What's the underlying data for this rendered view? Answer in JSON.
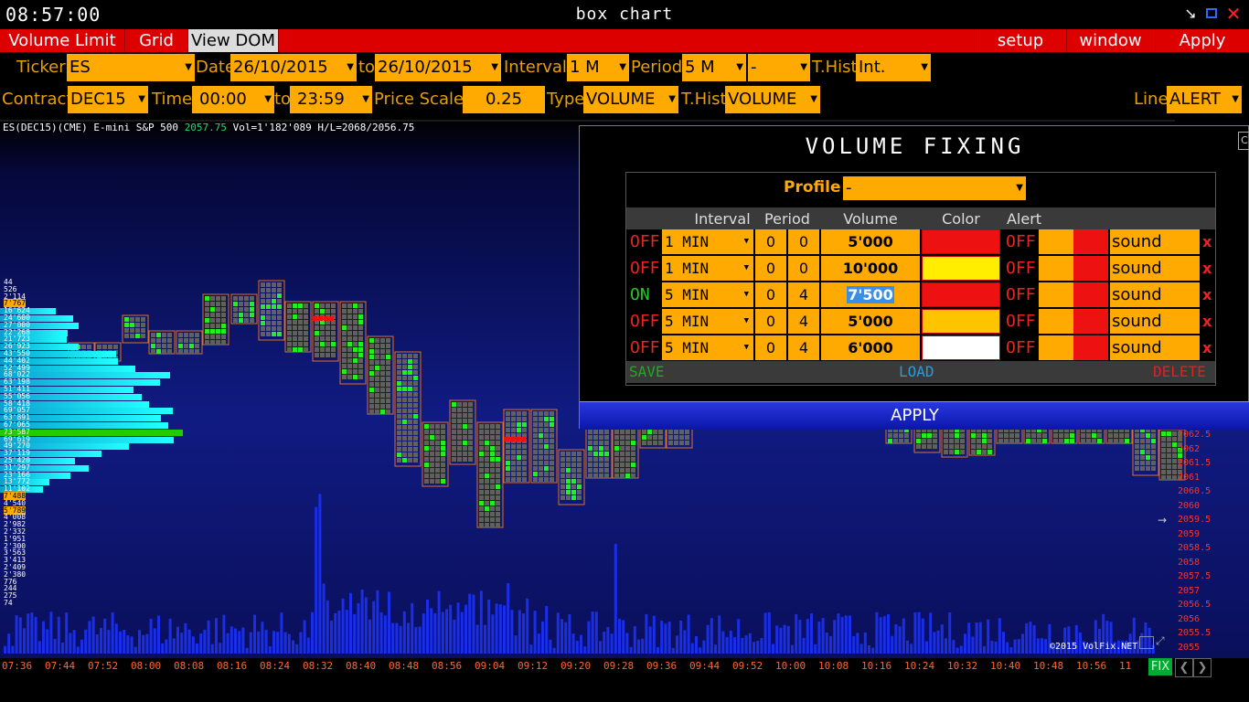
{
  "window": {
    "clock": "08:57:00",
    "title": "box chart"
  },
  "icons": {
    "minimize": "minimize-icon",
    "restore": "restore-icon",
    "close": "close-icon"
  },
  "menubar": {
    "left": [
      "Volume Limit",
      "Grid",
      "View DOM"
    ],
    "right": [
      "setup",
      "window",
      "Apply"
    ]
  },
  "params": {
    "ticker_label": "Ticker",
    "ticker": "ES",
    "date_label": "Date",
    "date_from": "26/10/2015",
    "to_label": "to",
    "date_to": "26/10/2015",
    "interval_label": "Interval",
    "interval": "1 M",
    "period_label": "Period",
    "period": "5 M",
    "period2": "-",
    "thist_label": "T.Hist",
    "thist1": "Int.",
    "contract_label": "Contract",
    "contract": "DEC15",
    "time_label": "Time",
    "time_from": "00:00",
    "time_to_label": "to",
    "time_to": "23:59",
    "price_scale_label": "Price Scale",
    "price_scale": "0.25",
    "type_label": "Type",
    "type": "VOLUME",
    "thist2_label": "T.Hist",
    "thist2": "VOLUME",
    "line_label": "Line",
    "line": "ALERT"
  },
  "chart": {
    "info_prefix": "ES(DEC15)(CME) E-mini S&P 500",
    "last_price": "2057.75",
    "info_suffix": "Vol=1'182'089 H/L=2068/2056.75",
    "copyright": "©2015 VolFix.NET",
    "profile_labels": [
      "44",
      "526",
      "2'114",
      "7'767",
      "16'624",
      "24'600",
      "27'000",
      "22'268",
      "21'723",
      "26'923",
      "43'550",
      "44'402",
      "52'499",
      "68'022",
      "63'198",
      "51'411",
      "55'056",
      "58'418",
      "69'057",
      "63'891",
      "67'065",
      "73'587",
      "69'619",
      "49'270",
      "37'119",
      "25'420",
      "31'297",
      "23'166",
      "13'772",
      "11'102",
      "7'488",
      "4'540",
      "5'789",
      "4'008",
      "2'982",
      "2'332",
      "1'951",
      "2'300",
      "3'563",
      "3'413",
      "2'409",
      "2'380",
      "776",
      "244",
      "275",
      "74"
    ],
    "price_levels": [
      "2062.5",
      "2062",
      "2061.5",
      "2061",
      "2060.5",
      "2060",
      "2059.5",
      "2059",
      "2058.5",
      "2058",
      "2057.5",
      "2057",
      "2056.5",
      "2056",
      "2055.5",
      "2055"
    ],
    "time_labels": [
      "07:36",
      "07:44",
      "07:52",
      "08:00",
      "08:08",
      "08:16",
      "08:24",
      "08:32",
      "08:40",
      "08:48",
      "08:56",
      "09:04",
      "09:12",
      "09:20",
      "09:28",
      "09:36",
      "09:44",
      "09:52",
      "10:00",
      "10:08",
      "10:16",
      "10:24",
      "10:32",
      "10:40",
      "10:48",
      "10:56",
      "11"
    ],
    "fix_label": "FIX"
  },
  "volume_fixing": {
    "title": "VOLUME FIXING",
    "profile_label": "Profile",
    "profile_value": "-",
    "headers": {
      "interval": "Interval",
      "period": "Period",
      "volume": "Volume",
      "color": "Color",
      "alert": "Alert"
    },
    "rows": [
      {
        "state": "OFF",
        "interval": "1 MIN",
        "p1": "0",
        "p2": "0",
        "volume": "5'000",
        "color": "#ee1111",
        "alert": "OFF",
        "alert_color": "#ee1111",
        "sound": "sound",
        "del": "x"
      },
      {
        "state": "OFF",
        "interval": "1 MIN",
        "p1": "0",
        "p2": "0",
        "volume": "10'000",
        "color": "#ffee00",
        "alert": "OFF",
        "alert_color": "#ee1111",
        "sound": "sound",
        "del": "x"
      },
      {
        "state": "ON",
        "interval": "5 MIN",
        "p1": "0",
        "p2": "4",
        "volume": "7'500",
        "color": "#ee1111",
        "alert": "OFF",
        "alert_color": "#ee1111",
        "sound": "sound",
        "del": "x"
      },
      {
        "state": "OFF",
        "interval": "5 MIN",
        "p1": "0",
        "p2": "4",
        "volume": "5'000",
        "color": "#ffc400",
        "alert": "OFF",
        "alert_color": "#ee1111",
        "sound": "sound",
        "del": "x"
      },
      {
        "state": "OFF",
        "interval": "5 MIN",
        "p1": "0",
        "p2": "4",
        "volume": "6'000",
        "color": "#ffffff",
        "alert": "OFF",
        "alert_color": "#ee1111",
        "sound": "sound",
        "del": "x"
      }
    ],
    "save": "SAVE",
    "load": "LOAD",
    "delete": "DELETE",
    "apply": "APPLY"
  },
  "colors": {
    "accent": "#ffaa00",
    "menubar": "#dd0000",
    "label": "#e8a000",
    "on": "#22cc22",
    "off": "#ee2222"
  }
}
